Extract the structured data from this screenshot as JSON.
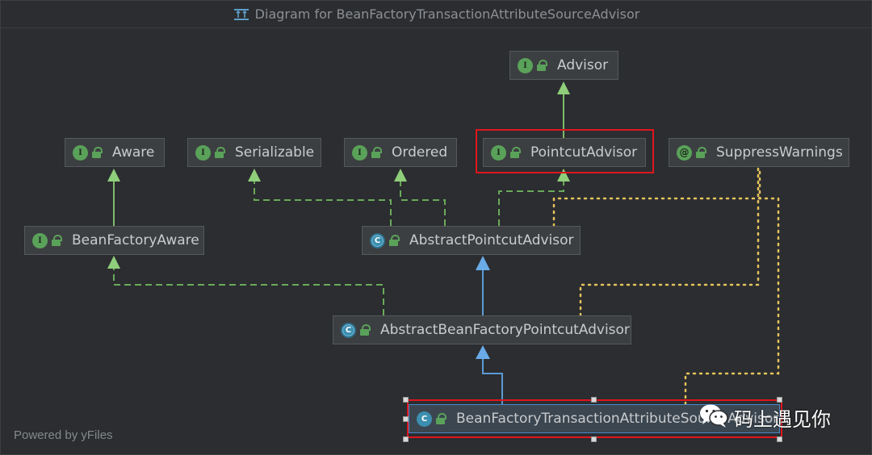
{
  "window": {
    "title": "Diagram for BeanFactoryTransactionAttributeSourceAdvisor"
  },
  "nodes": {
    "advisor": {
      "label": "Advisor",
      "kind": "interface",
      "icon": "interface-badge-icon"
    },
    "aware": {
      "label": "Aware",
      "kind": "interface",
      "icon": "interface-badge-icon"
    },
    "serializable": {
      "label": "Serializable",
      "kind": "interface",
      "icon": "interface-badge-icon"
    },
    "ordered": {
      "label": "Ordered",
      "kind": "interface",
      "icon": "interface-badge-icon"
    },
    "pointcut_advisor": {
      "label": "PointcutAdvisor",
      "kind": "interface",
      "icon": "interface-badge-icon"
    },
    "suppress_warnings": {
      "label": "SuppressWarnings",
      "kind": "annotation",
      "icon": "annotation-badge-icon"
    },
    "bean_factory_aware": {
      "label": "BeanFactoryAware",
      "kind": "interface",
      "icon": "interface-badge-icon"
    },
    "abstract_pointcut_advisor": {
      "label": "AbstractPointcutAdvisor",
      "kind": "abstract-class",
      "icon": "abstract-class-badge-icon"
    },
    "abstract_bf_pointcut_advisor": {
      "label": "AbstractBeanFactoryPointcutAdvisor",
      "kind": "abstract-class",
      "icon": "abstract-class-badge-icon"
    },
    "bf_tx_attr_source_advisor": {
      "label": "BeanFactoryTransactionAttributeSourceAdvisor",
      "kind": "class",
      "icon": "class-badge-icon"
    }
  },
  "badges": {
    "interface": "I",
    "class": "C",
    "abstract_class": "C",
    "annotation": "@"
  },
  "edge_legend": {
    "implements": "dashed green with hollow green arrow",
    "extends": "solid blue with hollow blue arrow",
    "interface_extends": "solid green with hollow green arrow",
    "annotated_with": "dotted yellow"
  },
  "colors": {
    "background": "#2b2d30",
    "node_fill": "#3c3f41",
    "interface_green": "#5aa25a",
    "extends_blue": "#5b9bd5",
    "implements_green": "#6aaa5a",
    "annotation_dotted": "#e6c35c",
    "highlight_red": "#e0161d"
  },
  "footer": {
    "powered_by": "Powered by yFiles"
  },
  "watermark": {
    "text": "码上遇见你",
    "icon": "wechat-icon"
  }
}
